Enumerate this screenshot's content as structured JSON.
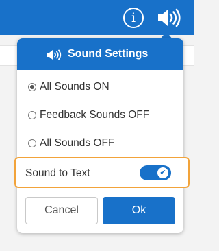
{
  "topbar": {
    "accent_color": "#1871c9",
    "info_icon_text": "i",
    "info_icon": "info-icon",
    "speaker_icon": "speaker-icon"
  },
  "panel": {
    "title": "Sound Settings",
    "header_icon": "speaker-icon",
    "options": [
      {
        "label": "All Sounds ON",
        "selected": true
      },
      {
        "label": "Feedback Sounds OFF",
        "selected": false
      },
      {
        "label": "All Sounds OFF",
        "selected": false
      }
    ],
    "sound_to_text": {
      "label": "Sound to Text",
      "enabled": true,
      "highlight_color": "#f2a33a"
    },
    "buttons": {
      "cancel": "Cancel",
      "ok": "Ok"
    }
  }
}
